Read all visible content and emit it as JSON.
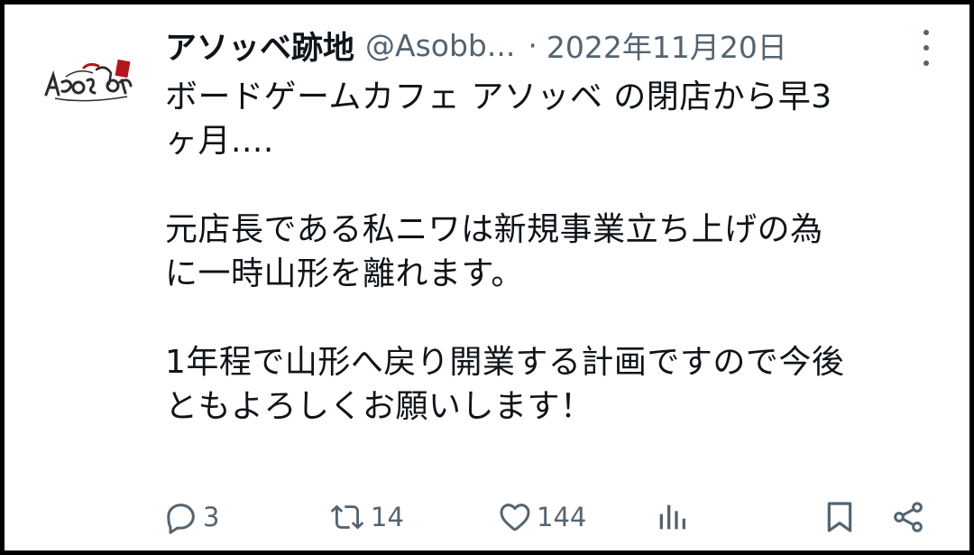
{
  "tweet": {
    "display_name": "アソッベ跡地",
    "handle": "@Asobb...",
    "separator": "·",
    "date": "2022年11月20日",
    "avatar_icon": "asobbe-logo-avatar",
    "lines": [
      "ボードゲームカフェ アソッベ の閉店から早3",
      "ヶ月....",
      "",
      "元店長である私ニワは新規事業立ち上げの為",
      "に一時山形を離れます。",
      "",
      "1年程で山形へ戻り開業する計画ですので今後",
      "ともよろしくお願いします！"
    ]
  },
  "actions": {
    "reply": {
      "icon": "reply-icon",
      "count": "3"
    },
    "retweet": {
      "icon": "retweet-icon",
      "count": "14"
    },
    "like": {
      "icon": "heart-icon",
      "count": "144"
    },
    "views": {
      "icon": "views-icon"
    },
    "bookmark": {
      "icon": "bookmark-icon"
    },
    "share": {
      "icon": "share-icon"
    }
  },
  "colors": {
    "text": "#0f1419",
    "secondary": "#536471",
    "frame": "#000000"
  }
}
